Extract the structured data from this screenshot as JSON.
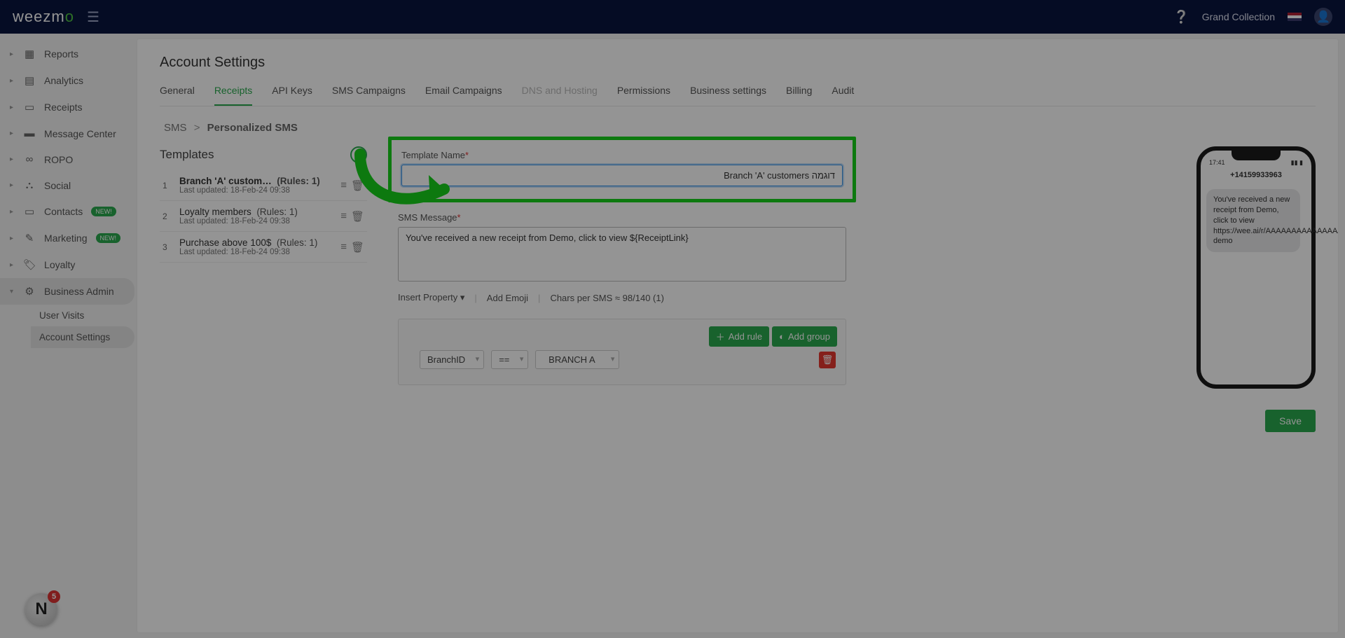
{
  "header": {
    "brand_a": "weezm",
    "brand_b": "o",
    "user": "Grand Collection"
  },
  "sidebar": {
    "items": [
      {
        "label": "Reports",
        "icon": "▦"
      },
      {
        "label": "Analytics",
        "icon": "▤"
      },
      {
        "label": "Receipts",
        "icon": "▭"
      },
      {
        "label": "Message Center",
        "icon": "▬"
      },
      {
        "label": "ROPO",
        "icon": "∞"
      },
      {
        "label": "Social",
        "icon": "⛬"
      },
      {
        "label": "Contacts",
        "icon": "▭",
        "new": true
      },
      {
        "label": "Marketing",
        "icon": "✎",
        "new": true
      },
      {
        "label": "Loyalty",
        "icon": "🏷"
      },
      {
        "label": "Business Admin",
        "icon": "⚙",
        "active": true
      }
    ],
    "sub": [
      {
        "label": "User Visits"
      },
      {
        "label": "Account Settings",
        "active": true
      }
    ],
    "new_badge": "NEW!"
  },
  "page": {
    "title": "Account Settings",
    "tabs": [
      {
        "label": "General"
      },
      {
        "label": "Receipts",
        "active": true
      },
      {
        "label": "API Keys"
      },
      {
        "label": "SMS Campaigns"
      },
      {
        "label": "Email Campaigns"
      },
      {
        "label": "DNS and Hosting",
        "disabled": true
      },
      {
        "label": "Permissions"
      },
      {
        "label": "Business settings"
      },
      {
        "label": "Billing"
      },
      {
        "label": "Audit"
      }
    ],
    "breadcrumb": {
      "a": "SMS",
      "sep": ">",
      "b": "Personalized SMS"
    }
  },
  "templates": {
    "header": "Templates",
    "list": [
      {
        "idx": "1",
        "name": "Branch 'A' custom…",
        "rules": "(Rules: 1)",
        "updated": "Last updated: 18-Feb-24 09:38",
        "sel": true
      },
      {
        "idx": "2",
        "name": "Loyalty members",
        "rules": "(Rules: 1)",
        "updated": "Last updated: 18-Feb-24 09:38"
      },
      {
        "idx": "3",
        "name": "Purchase above 100$",
        "rules": "(Rules: 1)",
        "updated": "Last updated: 18-Feb-24 09:38"
      }
    ]
  },
  "form": {
    "name_label": "Template Name",
    "name_value": "דוגמה Branch 'A' customers",
    "msg_label": "SMS Message",
    "msg_value": "You've received a new receipt from Demo, click to view ${ReceiptLink}",
    "insert_property": "Insert Property",
    "add_emoji": "Add Emoji",
    "chars": "Chars per SMS ≈ 98/140 (1)",
    "add_rule": "Add rule",
    "add_group": "Add group",
    "rule_field": "BranchID",
    "rule_op": "==",
    "rule_val": "BRANCH A",
    "save": "Save"
  },
  "phone": {
    "time": "17:41",
    "number": "+14159933963",
    "bubble": "You've received a new receipt from Demo, click to view https://wee.ai/r/AAAAAAAAAAAAAAAAAAAAA demo"
  },
  "notif": {
    "count": "5",
    "glyph": "N"
  }
}
